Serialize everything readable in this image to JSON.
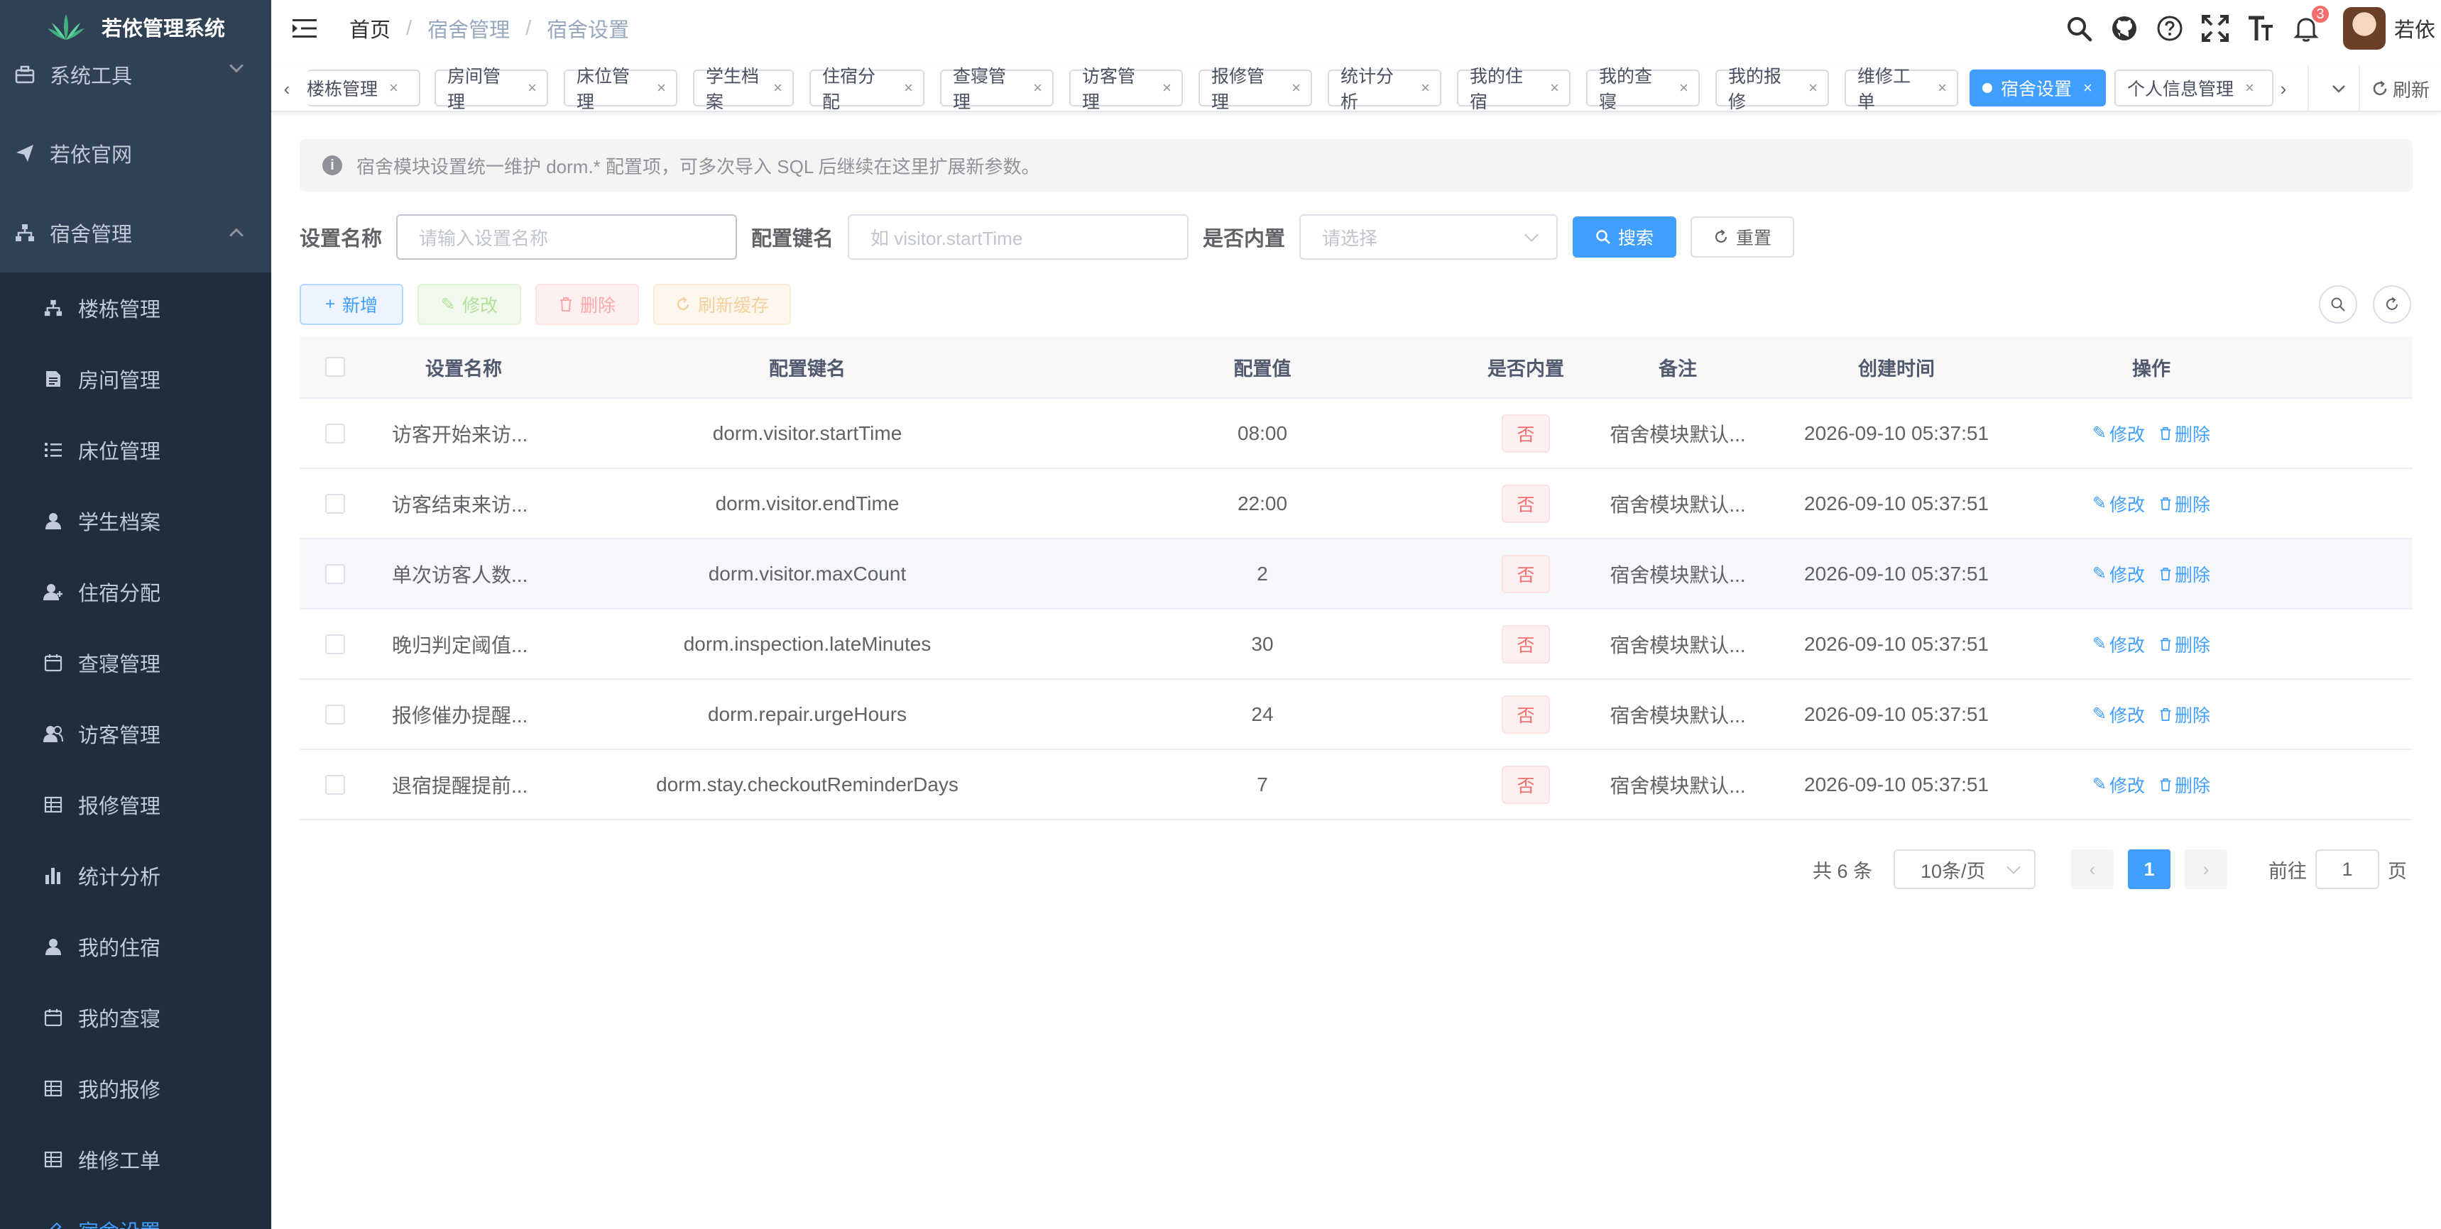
{
  "app": {
    "title": "若依管理系统"
  },
  "sidebar": {
    "top_items": [
      {
        "label": "系统工具",
        "icon": "toolbox-icon"
      },
      {
        "label": "若依官网",
        "icon": "send-icon"
      },
      {
        "label": "宿舍管理",
        "icon": "tree-icon"
      }
    ],
    "sub_items": [
      {
        "label": "楼栋管理",
        "icon": "tree-icon"
      },
      {
        "label": "房间管理",
        "icon": "document-icon"
      },
      {
        "label": "床位管理",
        "icon": "list-icon"
      },
      {
        "label": "学生档案",
        "icon": "user-icon"
      },
      {
        "label": "住宿分配",
        "icon": "user-plus-icon"
      },
      {
        "label": "查寝管理",
        "icon": "calendar-icon"
      },
      {
        "label": "访客管理",
        "icon": "users-icon"
      },
      {
        "label": "报修管理",
        "icon": "grid-icon"
      },
      {
        "label": "统计分析",
        "icon": "chart-icon"
      },
      {
        "label": "我的住宿",
        "icon": "user-icon"
      },
      {
        "label": "我的查寝",
        "icon": "calendar-icon"
      },
      {
        "label": "我的报修",
        "icon": "grid-icon"
      },
      {
        "label": "维修工单",
        "icon": "grid-icon"
      },
      {
        "label": "宿舍设置",
        "icon": "edit-icon"
      }
    ]
  },
  "breadcrumb": [
    "首页",
    "宿舍管理",
    "宿舍设置"
  ],
  "navbar": {
    "notification_count": "3",
    "user_name": "若依"
  },
  "tags": [
    "楼栋管理",
    "房间管理",
    "床位管理",
    "学生档案",
    "住宿分配",
    "查寝管理",
    "访客管理",
    "报修管理",
    "统计分析",
    "我的住宿",
    "我的查寝",
    "我的报修",
    "维修工单",
    "宿舍设置",
    "个人信息管理"
  ],
  "tags_active_index": 13,
  "tags_refresh_label": "刷新",
  "alert": {
    "text": "宿舍模块设置统一维护 dorm.* 配置项，可多次导入 SQL 后继续在这里扩展新参数。"
  },
  "search_form": {
    "name_label": "设置名称",
    "name_placeholder": "请输入设置名称",
    "key_label": "配置键名",
    "key_placeholder": "如 visitor.startTime",
    "builtin_label": "是否内置",
    "builtin_placeholder": "请选择",
    "search_btn": "搜索",
    "reset_btn": "重置"
  },
  "toolbar": {
    "add": "新增",
    "edit": "修改",
    "delete": "删除",
    "refresh_cache": "刷新缓存"
  },
  "table": {
    "headers": [
      "设置名称",
      "配置键名",
      "配置值",
      "是否内置",
      "备注",
      "创建时间",
      "操作"
    ],
    "rows": [
      {
        "name": "访客开始来访...",
        "key": "dorm.visitor.startTime",
        "value": "08:00",
        "builtin": "否",
        "remark": "宿舍模块默认...",
        "created": "2026-09-10 05:37:51"
      },
      {
        "name": "访客结束来访...",
        "key": "dorm.visitor.endTime",
        "value": "22:00",
        "builtin": "否",
        "remark": "宿舍模块默认...",
        "created": "2026-09-10 05:37:51"
      },
      {
        "name": "单次访客人数...",
        "key": "dorm.visitor.maxCount",
        "value": "2",
        "builtin": "否",
        "remark": "宿舍模块默认...",
        "created": "2026-09-10 05:37:51"
      },
      {
        "name": "晚归判定阈值...",
        "key": "dorm.inspection.lateMinutes",
        "value": "30",
        "builtin": "否",
        "remark": "宿舍模块默认...",
        "created": "2026-09-10 05:37:51"
      },
      {
        "name": "报修催办提醒...",
        "key": "dorm.repair.urgeHours",
        "value": "24",
        "builtin": "否",
        "remark": "宿舍模块默认...",
        "created": "2026-09-10 05:37:51"
      },
      {
        "name": "退宿提醒提前...",
        "key": "dorm.stay.checkoutReminderDays",
        "value": "7",
        "builtin": "否",
        "remark": "宿舍模块默认...",
        "created": "2026-09-10 05:37:51"
      }
    ],
    "op_edit": "修改",
    "op_delete": "删除"
  },
  "pagination": {
    "total_text": "共 6 条",
    "page_size": "10条/页",
    "current_page": "1",
    "goto_prefix": "前往",
    "goto_value": "1",
    "goto_suffix": "页"
  },
  "colors": {
    "sidebar_bg": "#304156",
    "submenu_bg": "#1f2d3d",
    "primary": "#409eff",
    "danger": "#f56c6c"
  }
}
